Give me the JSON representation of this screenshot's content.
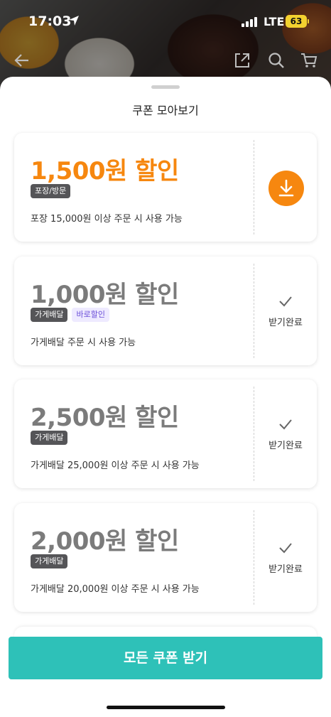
{
  "status_bar": {
    "time": "17:03",
    "network": "LTE",
    "battery": "63"
  },
  "sheet": {
    "title": "쿠폰 모아보기"
  },
  "colors": {
    "accent": "#f6870f",
    "used": "#7b7b7b",
    "cta": "#2ec1b8"
  },
  "coupons": [
    {
      "amount": "1,500원 할인",
      "tags": [
        "포장/방문"
      ],
      "condition": "포장 15,000원 이상 주문 시 사용 가능",
      "state": "download"
    },
    {
      "amount": "1,000원 할인",
      "tags": [
        "가게배달",
        "바로할인"
      ],
      "condition": "가게배달 주문 시 사용 가능",
      "state": "received",
      "state_label": "받기완료"
    },
    {
      "amount": "2,500원 할인",
      "tags": [
        "가게배달"
      ],
      "condition": "가게배달 25,000원 이상 주문 시 사용 가능",
      "state": "received",
      "state_label": "받기완료"
    },
    {
      "amount": "2,000원 할인",
      "tags": [
        "가게배달"
      ],
      "condition": "가게배달 20,000원 이상 주문 시 사용 가능",
      "state": "received",
      "state_label": "받기완료"
    }
  ],
  "cta": {
    "label": "모든 쿠폰 받기"
  }
}
